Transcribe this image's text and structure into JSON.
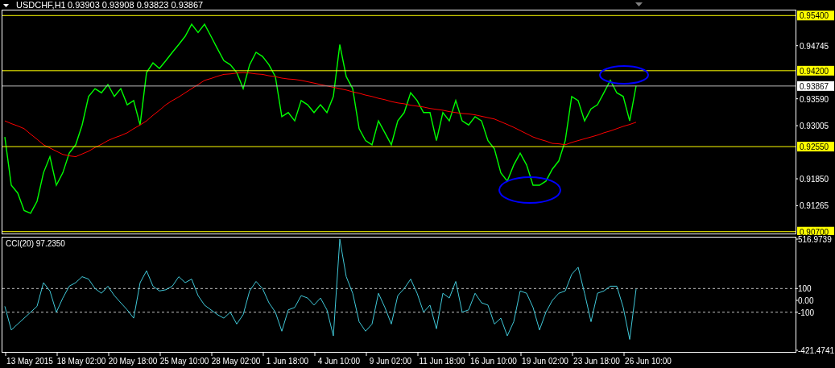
{
  "price_panel": {
    "header": {
      "symbol": "USDCHF,H1",
      "quote": "0.93903 0.93908 0.93823 0.93867"
    },
    "chart_data": {
      "type": "line",
      "categories": [
        null,
        null,
        null,
        null,
        null,
        null,
        null,
        null,
        null,
        null,
        null,
        null,
        null,
        null,
        null,
        null,
        null,
        null,
        null,
        null,
        null,
        null,
        null,
        null,
        null,
        null,
        null,
        null,
        null,
        null,
        null,
        null,
        null,
        null,
        null,
        null,
        null,
        null,
        null,
        null,
        null,
        null,
        null,
        null,
        null,
        null,
        null,
        null,
        null,
        null,
        null,
        null,
        null,
        null,
        null,
        null,
        null,
        null,
        null,
        null,
        null,
        null,
        null,
        null,
        null,
        null,
        null,
        null,
        null,
        null,
        null,
        null,
        null,
        null,
        null,
        null,
        null,
        null,
        null,
        null,
        null,
        null,
        null,
        null,
        null,
        null,
        null,
        null,
        null,
        null,
        null,
        null,
        null,
        null,
        null,
        null,
        null,
        null,
        null,
        null,
        null,
        null,
        null,
        null,
        null,
        null,
        null,
        null,
        null,
        null,
        null,
        null,
        null,
        null,
        null,
        null,
        null,
        null,
        null,
        null,
        null,
        null,
        null
      ],
      "series": [
        {
          "color": "#00ff00",
          "values": [
            0.9276,
            0.9171,
            0.9154,
            0.9116,
            0.911,
            0.9136,
            0.9198,
            0.9233,
            0.9171,
            0.9198,
            0.9241,
            0.9259,
            0.9302,
            0.9364,
            0.9381,
            0.9372,
            0.939,
            0.9364,
            0.9381,
            0.9346,
            0.9355,
            0.9302,
            0.9416,
            0.9437,
            0.9425,
            0.9442,
            0.946,
            0.9477,
            0.9495,
            0.9521,
            0.9503,
            0.9521,
            0.9495,
            0.9468,
            0.9442,
            0.9433,
            0.9416,
            0.9381,
            0.9433,
            0.946,
            0.9451,
            0.9433,
            0.9407,
            0.932,
            0.9329,
            0.9311,
            0.9355,
            0.9346,
            0.9329,
            0.9346,
            0.9329,
            0.9364,
            0.9477,
            0.9407,
            0.9381,
            0.9294,
            0.9268,
            0.9259,
            0.9311,
            0.9285,
            0.9259,
            0.9311,
            0.9329,
            0.9372,
            0.9355,
            0.9329,
            0.9329,
            0.9268,
            0.9329,
            0.9311,
            0.9355,
            0.9311,
            0.9302,
            0.932,
            0.9311,
            0.9268,
            0.925,
            0.9198,
            0.918,
            0.9215,
            0.9241,
            0.9215,
            0.9171,
            0.9171,
            0.918,
            0.9206,
            0.9224,
            0.9268,
            0.9364,
            0.9355,
            0.9311,
            0.9337,
            0.9346,
            0.9372,
            0.9399,
            0.9372,
            0.9364,
            0.9311,
            0.9387,
            null,
            null,
            null,
            null,
            null,
            null,
            null,
            null,
            null,
            null,
            null,
            null,
            null,
            null,
            null,
            null,
            null,
            null,
            null,
            null,
            null,
            null,
            null,
            null
          ]
        },
        {
          "color": "#ff0000",
          "values": [
            0.9311,
            0.9305,
            0.93,
            0.9294,
            0.9282,
            0.9271,
            0.9259,
            0.9252,
            0.9245,
            0.9238,
            0.9235,
            0.9233,
            0.9239,
            0.9245,
            0.9253,
            0.926,
            0.9268,
            0.9274,
            0.9279,
            0.9285,
            0.9294,
            0.9302,
            0.9311,
            0.9323,
            0.9334,
            0.9346,
            0.9355,
            0.9363,
            0.9372,
            0.9381,
            0.939,
            0.9399,
            0.9403,
            0.9408,
            0.9412,
            0.9413,
            0.9415,
            0.9416,
            0.9415,
            0.9413,
            0.9412,
            0.9409,
            0.9407,
            0.9404,
            0.9402,
            0.9401,
            0.9399,
            0.9396,
            0.9393,
            0.939,
            0.9387,
            0.9384,
            0.9381,
            0.9378,
            0.9374,
            0.9371,
            0.9367,
            0.9364,
            0.936,
            0.9357,
            0.9353,
            0.935,
            0.9348,
            0.9345,
            0.9343,
            0.9341,
            0.9338,
            0.9336,
            0.9334,
            0.9331,
            0.9329,
            0.9327,
            0.9326,
            0.9324,
            0.9321,
            0.9318,
            0.9315,
            0.9309,
            0.9303,
            0.9297,
            0.929,
            0.9283,
            0.9276,
            0.9271,
            0.9267,
            0.9262,
            0.9261,
            0.9259,
            0.9264,
            0.9268,
            0.9272,
            0.9276,
            0.928,
            0.9285,
            0.9289,
            0.9294,
            0.9299,
            0.9303,
            0.9308,
            null,
            null,
            null,
            null,
            null,
            null,
            null,
            null,
            null,
            null,
            null,
            null,
            null,
            null,
            null,
            null,
            null,
            null,
            null,
            null,
            null,
            null,
            null,
            null
          ]
        }
      ],
      "ylim": [
        0.9066,
        0.9551
      ],
      "yticks": [
        {
          "value": 0.94745,
          "label": "0.94745"
        },
        {
          "value": 0.9359,
          "label": "0.93590"
        },
        {
          "value": 0.93005,
          "label": "0.93005"
        },
        {
          "value": 0.9185,
          "label": "0.91850"
        },
        {
          "value": 0.91265,
          "label": "0.91265"
        }
      ],
      "ref_lines": [
        {
          "axis": "y",
          "value": 0.954,
          "label": "0.95400",
          "color": "#ffff00"
        },
        {
          "axis": "y",
          "value": 0.942,
          "label": "0.94200",
          "color": "#ffff00"
        },
        {
          "axis": "y",
          "value": 0.93867,
          "label": "0.93867",
          "color": "#c0c0c0"
        },
        {
          "axis": "y",
          "value": 0.9255,
          "label": "0.92550",
          "color": "#ffff00"
        },
        {
          "axis": "y",
          "value": 0.907,
          "label": "0.90700",
          "color": "#ffff00"
        }
      ]
    }
  },
  "cci_panel": {
    "label": "CCI(20) 97.2350",
    "chart_data": {
      "type": "line",
      "categories": [
        null,
        null,
        null,
        null,
        "13 May 2015",
        null,
        null,
        null,
        null,
        null,
        null,
        null,
        "18 May 02:00",
        null,
        null,
        null,
        null,
        null,
        null,
        null,
        "20 May 18:00",
        null,
        null,
        null,
        null,
        null,
        null,
        null,
        "25 May 10:00",
        null,
        null,
        null,
        null,
        null,
        null,
        null,
        "28 May 02:00",
        null,
        null,
        null,
        null,
        null,
        null,
        null,
        "1 Jun 18:00",
        null,
        null,
        null,
        null,
        null,
        null,
        null,
        "4 Jun 10:00",
        null,
        null,
        null,
        null,
        null,
        null,
        null,
        "9 Jun 02:00",
        null,
        null,
        null,
        null,
        null,
        null,
        null,
        "11 Jun 18:00",
        null,
        null,
        null,
        null,
        null,
        null,
        null,
        "16 Jun 10:00",
        null,
        null,
        null,
        null,
        null,
        null,
        null,
        "19 Jun 02:00",
        null,
        null,
        null,
        null,
        null,
        null,
        null,
        "23 Jun 18:00",
        null,
        null,
        null,
        null,
        null,
        null,
        null,
        "26 Jun 10:00",
        null,
        null,
        null,
        null,
        null,
        null,
        null,
        null,
        null,
        null,
        null,
        null,
        null,
        null,
        null,
        null,
        null,
        null,
        null,
        null,
        null,
        null
      ],
      "series": [
        {
          "color": "#40c8d8",
          "values": [
            -50,
            -250,
            -200,
            -150,
            -100,
            -50,
            150,
            80,
            -100,
            20,
            120,
            150,
            200,
            180,
            100,
            60,
            120,
            40,
            -20,
            -80,
            -150,
            150,
            250,
            120,
            80,
            90,
            120,
            200,
            150,
            180,
            40,
            -40,
            -80,
            -120,
            -150,
            -100,
            -200,
            -120,
            80,
            160,
            100,
            -20,
            -100,
            -260,
            -80,
            -60,
            40,
            20,
            -40,
            20,
            -80,
            -300,
            516,
            200,
            60,
            -180,
            -260,
            -200,
            60,
            -60,
            -200,
            40,
            100,
            180,
            60,
            -100,
            -40,
            -240,
            60,
            20,
            160,
            -100,
            -80,
            60,
            -20,
            -40,
            -200,
            -150,
            -300,
            -180,
            80,
            60,
            -60,
            -250,
            -100,
            0,
            60,
            80,
            220,
            280,
            60,
            -180,
            60,
            80,
            120,
            120,
            -60,
            -330,
            97,
            null,
            null,
            null,
            null,
            null,
            null,
            null,
            null,
            null,
            null,
            null,
            null,
            null,
            null,
            null,
            null,
            null,
            null,
            null,
            null,
            null,
            null,
            null,
            null
          ]
        }
      ],
      "ylim": [
        -421.4741,
        516.9739
      ],
      "yticks": [
        {
          "value": 516.9739,
          "label": "516.9739"
        },
        {
          "value": 100,
          "label": "100"
        },
        {
          "value": 0,
          "label": "0.00"
        },
        {
          "value": -100,
          "label": "-100"
        },
        {
          "value": -421.4741,
          "label": "-421.4741"
        }
      ],
      "ref_lines": [
        {
          "axis": "y",
          "value": 100,
          "color": "#c0c0c0"
        },
        {
          "axis": "y",
          "value": -100,
          "color": "#c0c0c0"
        }
      ]
    }
  }
}
